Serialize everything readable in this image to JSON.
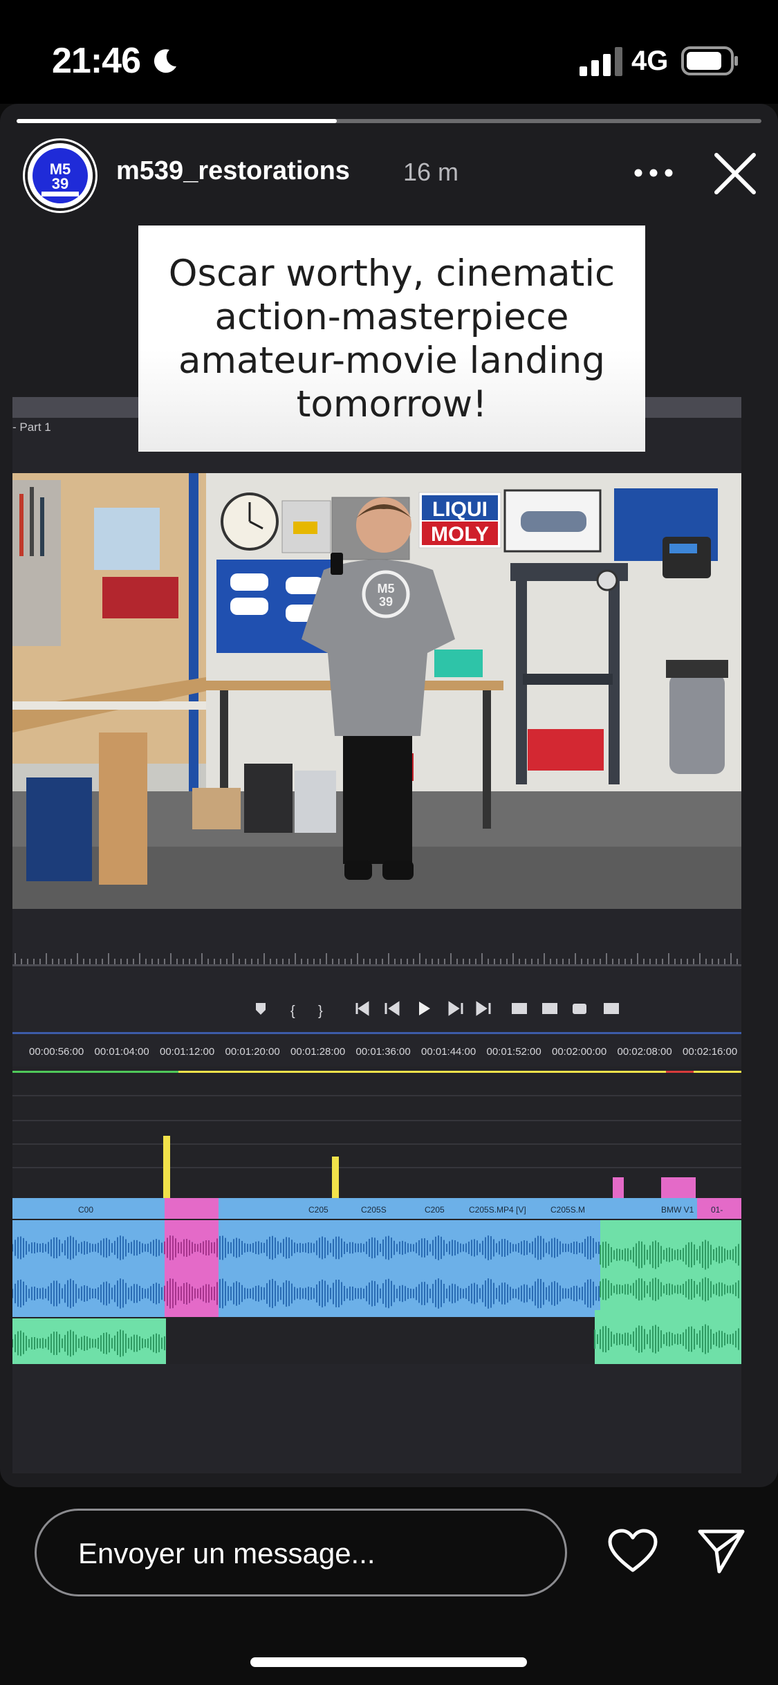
{
  "status_bar": {
    "time": "21:46",
    "network": "4G",
    "focus_icon": "moon-icon",
    "signal_icon": "cellular-signal-icon",
    "battery_icon": "battery-icon"
  },
  "story": {
    "progress": 0.43,
    "user": {
      "name": "m539_restorations",
      "avatar_text": "M5 39",
      "avatar_sub": "RESTORATIONS"
    },
    "time_ago": "16 m",
    "more_icon": "more-horizontal-icon",
    "close_icon": "close-icon",
    "caption": "Oscar worthy, cinematic action-masterpiece amateur-movie landing tomorrow!",
    "media": {
      "sequence_label": "- Part 1",
      "timecodes": [
        "00:00:56:00",
        "00:01:04:00",
        "00:01:12:00",
        "00:01:20:00",
        "00:01:28:00",
        "00:01:36:00",
        "00:01:44:00",
        "00:01:52:00",
        "00:02:00:00",
        "00:02:08:00",
        "00:02:16:00"
      ],
      "clip_labels": [
        "C00",
        "C205",
        "C205S",
        "C205",
        "C205S.MP4 [V]",
        "C205S.M",
        "BMW V1",
        "01-"
      ],
      "poster_text": "LIQUI MOLY",
      "hoodie_text": "M5 39"
    }
  },
  "bottom_bar": {
    "message_placeholder": "Envoyer un message...",
    "like_icon": "heart-icon",
    "send_icon": "send-icon"
  },
  "colors": {
    "background": "#1d1d20",
    "caption_bg": "#ffffff",
    "avatar_blue": "#1f2bd8",
    "clip_blue": "#6cb0e8",
    "clip_pink": "#e46ac8",
    "audio_green": "#6fe0a8",
    "playhead_yellow": "#f2e24a"
  }
}
